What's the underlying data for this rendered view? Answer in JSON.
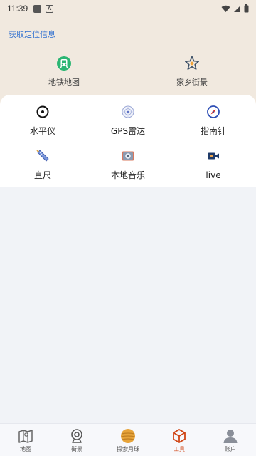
{
  "status_bar": {
    "time": "11:39"
  },
  "header": {
    "location_link": "获取定位信息",
    "tools": [
      {
        "label": "地铁地图",
        "icon": "metro-icon"
      },
      {
        "label": "家乡街景",
        "icon": "star-location-icon"
      }
    ]
  },
  "tools": [
    {
      "label": "水平仪",
      "icon": "level-icon"
    },
    {
      "label": "GPS雷达",
      "icon": "radar-icon"
    },
    {
      "label": "指南针",
      "icon": "compass-icon"
    },
    {
      "label": "直尺",
      "icon": "ruler-icon"
    },
    {
      "label": "本地音乐",
      "icon": "music-player-icon"
    },
    {
      "label": "live",
      "icon": "video-camera-icon"
    }
  ],
  "bottom_nav": {
    "items": [
      {
        "label": "地图",
        "icon": "map-icon"
      },
      {
        "label": "街景",
        "icon": "webcam-icon"
      },
      {
        "label": "探索月球",
        "icon": "moon-planet-icon"
      },
      {
        "label": "工具",
        "icon": "toolbox-icon",
        "active": true
      },
      {
        "label": "账户",
        "icon": "user-icon"
      }
    ]
  },
  "colors": {
    "header_bg": "#f1e9df",
    "link": "#2f6fd0",
    "metro_green": "#2bb673",
    "active_nav": "#d04515"
  }
}
